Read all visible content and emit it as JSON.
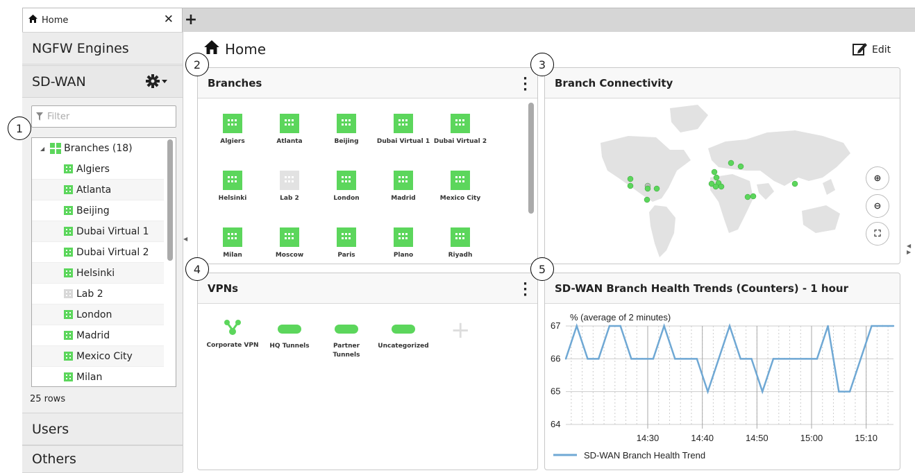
{
  "tab": {
    "title": "Home"
  },
  "sidebar": {
    "sections": [
      "NGFW Engines",
      "SD-WAN",
      "Users",
      "Others"
    ],
    "filter_placeholder": "Filter",
    "tree_root": "Branches (18)",
    "tree_items": [
      {
        "label": "Algiers",
        "status": "up"
      },
      {
        "label": "Atlanta",
        "status": "up"
      },
      {
        "label": "Beijing",
        "status": "up"
      },
      {
        "label": "Dubai Virtual 1",
        "status": "up"
      },
      {
        "label": "Dubai Virtual 2",
        "status": "up"
      },
      {
        "label": "Helsinki",
        "status": "up"
      },
      {
        "label": "Lab 2",
        "status": "unknown"
      },
      {
        "label": "London",
        "status": "up"
      },
      {
        "label": "Madrid",
        "status": "up"
      },
      {
        "label": "Mexico City",
        "status": "up"
      },
      {
        "label": "Milan",
        "status": "up"
      }
    ],
    "row_count": "25 rows"
  },
  "main": {
    "title": "Home",
    "edit_label": "Edit"
  },
  "branches_panel": {
    "title": "Branches",
    "tiles": [
      {
        "label": "Algiers",
        "status": "up"
      },
      {
        "label": "Atlanta",
        "status": "up"
      },
      {
        "label": "Beijing",
        "status": "up"
      },
      {
        "label": "Dubai Virtual 1",
        "status": "up"
      },
      {
        "label": "Dubai Virtual 2",
        "status": "up"
      },
      {
        "label": "Helsinki",
        "status": "up"
      },
      {
        "label": "Lab 2",
        "status": "unknown"
      },
      {
        "label": "London",
        "status": "up"
      },
      {
        "label": "Madrid",
        "status": "up"
      },
      {
        "label": "Mexico City",
        "status": "up"
      },
      {
        "label": "Milan",
        "status": "up"
      },
      {
        "label": "Moscow",
        "status": "up"
      },
      {
        "label": "Paris",
        "status": "up"
      },
      {
        "label": "Plano",
        "status": "up"
      },
      {
        "label": "Riyadh",
        "status": "up"
      }
    ]
  },
  "connectivity_panel": {
    "title": "Branch Connectivity"
  },
  "vpns_panel": {
    "title": "VPNs",
    "items": [
      {
        "label": "Corporate VPN",
        "icon": "hub-icon"
      },
      {
        "label": "HQ Tunnels",
        "icon": "tunnel-icon"
      },
      {
        "label": "Partner Tunnels",
        "icon": "tunnel-icon"
      },
      {
        "label": "Uncategorized",
        "icon": "tunnel-icon"
      }
    ]
  },
  "trends_panel": {
    "title": "SD-WAN Branch Health Trends (Counters) - 1 hour"
  },
  "callouts": [
    "1",
    "2",
    "3",
    "4",
    "5"
  ],
  "colors": {
    "status_up": "#5cd65c",
    "status_unknown": "#d8d8d8",
    "line": "#6fa8d4"
  },
  "chart_data": {
    "type": "line",
    "ylabel": "% (average of 2 minutes)",
    "ylim": [
      64,
      67
    ],
    "yticks": [
      64,
      65,
      66,
      67
    ],
    "xticks": [
      "14:30",
      "14:40",
      "14:50",
      "15:00",
      "15:10"
    ],
    "series": [
      {
        "name": "SD-WAN Branch Health Trend",
        "x": [
          "14:15",
          "14:17",
          "14:19",
          "14:21",
          "14:23",
          "14:25",
          "14:27",
          "14:29",
          "14:31",
          "14:33",
          "14:35",
          "14:37",
          "14:39",
          "14:41",
          "14:43",
          "14:45",
          "14:47",
          "14:49",
          "14:51",
          "14:53",
          "14:55",
          "14:57",
          "14:59",
          "15:01",
          "15:03",
          "15:05",
          "15:07",
          "15:09",
          "15:11",
          "15:13",
          "15:15"
        ],
        "values": [
          66,
          67,
          66,
          66,
          67,
          67,
          66,
          66,
          66,
          67,
          66,
          66,
          66,
          65,
          66,
          67,
          66,
          66,
          65,
          66,
          66,
          66,
          66,
          66,
          67,
          65,
          65,
          66,
          67,
          67,
          67
        ]
      }
    ]
  }
}
